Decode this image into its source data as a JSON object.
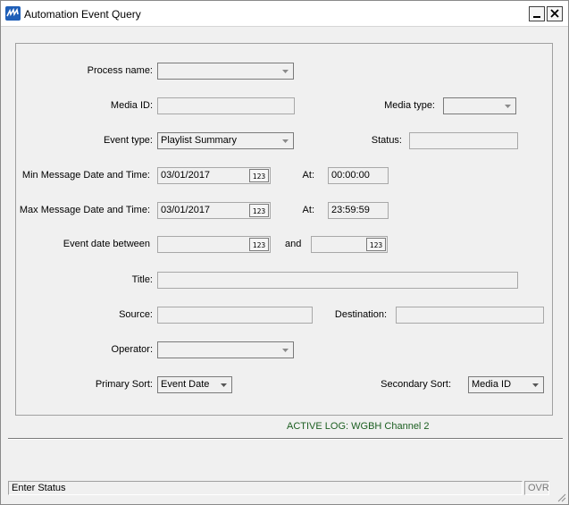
{
  "window": {
    "title": "Automation Event Query",
    "minimize_icon": "minimize-icon",
    "close_icon": "close-icon"
  },
  "form": {
    "process_name": {
      "label": "Process name:",
      "value": ""
    },
    "media_id": {
      "label": "Media ID:",
      "value": ""
    },
    "media_type": {
      "label": "Media type:",
      "value": ""
    },
    "event_type": {
      "label": "Event type:",
      "value": "Playlist Summary"
    },
    "status": {
      "label": "Status:",
      "value": ""
    },
    "min_date": {
      "label": "Min Message Date and Time:",
      "date": "03/01/2017",
      "at_label": "At:",
      "time": "00:00:00"
    },
    "max_date": {
      "label": "Max Message Date and Time:",
      "date": "03/01/2017",
      "at_label": "At:",
      "time": "23:59:59"
    },
    "event_date": {
      "label": "Event date between",
      "from": "",
      "and_label": "and",
      "to": ""
    },
    "title": {
      "label": "Title:",
      "value": ""
    },
    "source": {
      "label": "Source:",
      "value": ""
    },
    "destination": {
      "label": "Destination:",
      "value": ""
    },
    "operator": {
      "label": "Operator:",
      "value": ""
    },
    "primary_sort": {
      "label": "Primary Sort:",
      "value": "Event Date"
    },
    "secondary_sort": {
      "label": "Secondary Sort:",
      "value": "Media ID"
    }
  },
  "active_log": "ACTIVE LOG: WGBH Channel 2",
  "statusbar": {
    "message": "Enter Status",
    "mode": "OVR"
  },
  "colors": {
    "active_log": "#1b5e20",
    "app_icon": "#1f5fb8"
  }
}
